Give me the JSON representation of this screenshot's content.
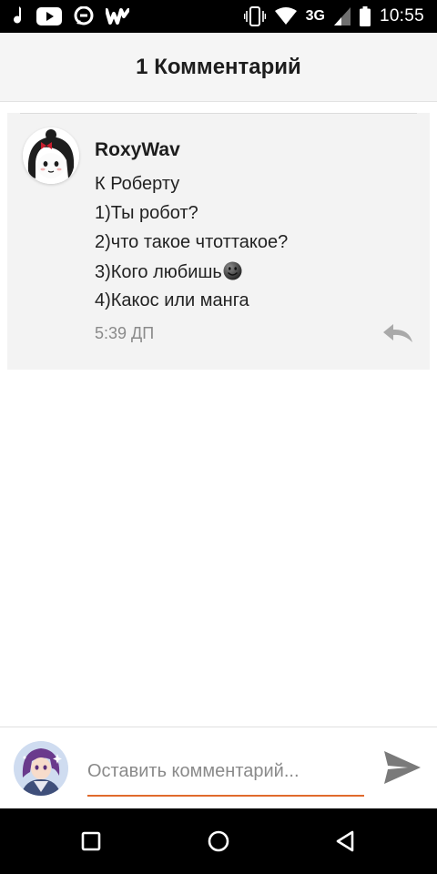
{
  "status_bar": {
    "left_icons": [
      "music-note-icon",
      "youtube-icon",
      "amino-icon",
      "wattpad-icon"
    ],
    "right_icons": [
      "vibrate-icon",
      "wifi-icon",
      "signal-icon",
      "battery-icon"
    ],
    "network": "3G",
    "time": "10:55"
  },
  "header": {
    "title": "1 Комментарий"
  },
  "comment": {
    "author": "RoxyWav",
    "lines": [
      "К Роберту",
      "1)Ты робот?",
      "2)что такое чтоттакое?",
      "3)Кого любишь",
      "4)Какос или манга"
    ],
    "emoji": "smiley-icon",
    "time": "5:39 ДП"
  },
  "composer": {
    "placeholder": "Оставить комментарий...",
    "value": "",
    "send_icon": "send-icon"
  },
  "nav": {
    "buttons": [
      "recent-apps-icon",
      "home-icon",
      "back-icon"
    ]
  },
  "colors": {
    "accent": "#e06a2c",
    "card_bg": "#f3f3f3",
    "header_bg": "#f5f5f5"
  }
}
